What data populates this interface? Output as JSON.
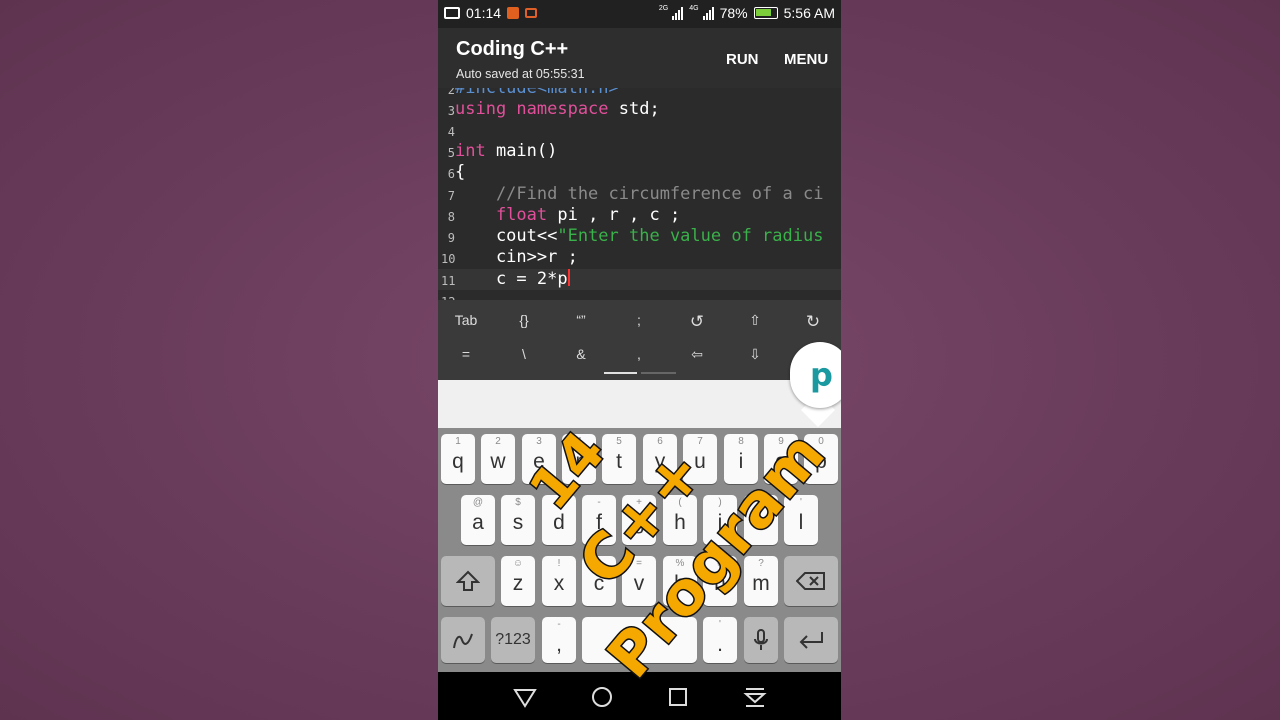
{
  "status_bar": {
    "time_left": "01:14",
    "net1": "2G",
    "net2": "4G",
    "battery": "78%",
    "clock": "5:56 AM",
    "icons": [
      "screen-record-icon",
      "notification-icon",
      "cast-icon",
      "signal-icon",
      "battery-icon"
    ]
  },
  "app_bar": {
    "title": "Coding C++",
    "subtitle": "Auto saved at 05:55:31",
    "run_label": "RUN",
    "menu_label": "MENU"
  },
  "editor": {
    "lines": [
      {
        "num": "2",
        "text": "#include<math.h>"
      },
      {
        "num": "3",
        "kw": "using namespace",
        "rest": " std;"
      },
      {
        "num": "4",
        "text": ""
      },
      {
        "num": "5",
        "kw": "int",
        "rest": " main()"
      },
      {
        "num": "6",
        "text": "{"
      },
      {
        "num": "7",
        "comment": "    //Find the circumference of a ci"
      },
      {
        "num": "8",
        "kw": "    float",
        "rest": " pi , r , c ;"
      },
      {
        "num": "9",
        "pre": "    cout<<",
        "str": "\"Enter the value of radius"
      },
      {
        "num": "10",
        "text": "    cin>>r ;"
      },
      {
        "num": "11",
        "text": "    c = 2*p"
      },
      {
        "num": "12",
        "text": ""
      }
    ]
  },
  "symbol_bar": {
    "row1": [
      "Tab",
      "{}",
      "“”",
      ";",
      "↺",
      "⇧",
      "↻"
    ],
    "row2": [
      "=",
      "\\",
      "&",
      ",",
      "⇦",
      "⇩"
    ]
  },
  "key_popup": "p",
  "keyboard": {
    "row1": [
      [
        "1",
        "q"
      ],
      [
        "2",
        "w"
      ],
      [
        "3",
        "e"
      ],
      [
        "4",
        "r"
      ],
      [
        "5",
        "t"
      ],
      [
        "6",
        "y"
      ],
      [
        "7",
        "u"
      ],
      [
        "8",
        "i"
      ],
      [
        "9",
        "o"
      ],
      [
        "0",
        "p"
      ]
    ],
    "row2": [
      [
        "@",
        "a"
      ],
      [
        "$",
        "s"
      ],
      [
        "&",
        "d"
      ],
      [
        "-",
        "f"
      ],
      [
        "+",
        "g"
      ],
      [
        "(",
        "h"
      ],
      [
        ")",
        "j"
      ],
      [
        "/",
        "k"
      ],
      [
        "'",
        "l"
      ]
    ],
    "row3": [
      [
        "☺",
        "z"
      ],
      [
        "!",
        "x"
      ],
      [
        "\"",
        "c"
      ],
      [
        "=",
        "v"
      ],
      [
        "%",
        "b"
      ],
      [
        "#",
        "n"
      ],
      [
        "?",
        "m"
      ]
    ],
    "bottom": {
      "sym": "?123",
      "comma_hint": "-",
      "comma": ",",
      "period_hint": "'",
      "period": "."
    }
  },
  "overlay": {
    "line1": "14",
    "line2": "C++",
    "line3": "Program",
    "color": "#f5a800"
  }
}
